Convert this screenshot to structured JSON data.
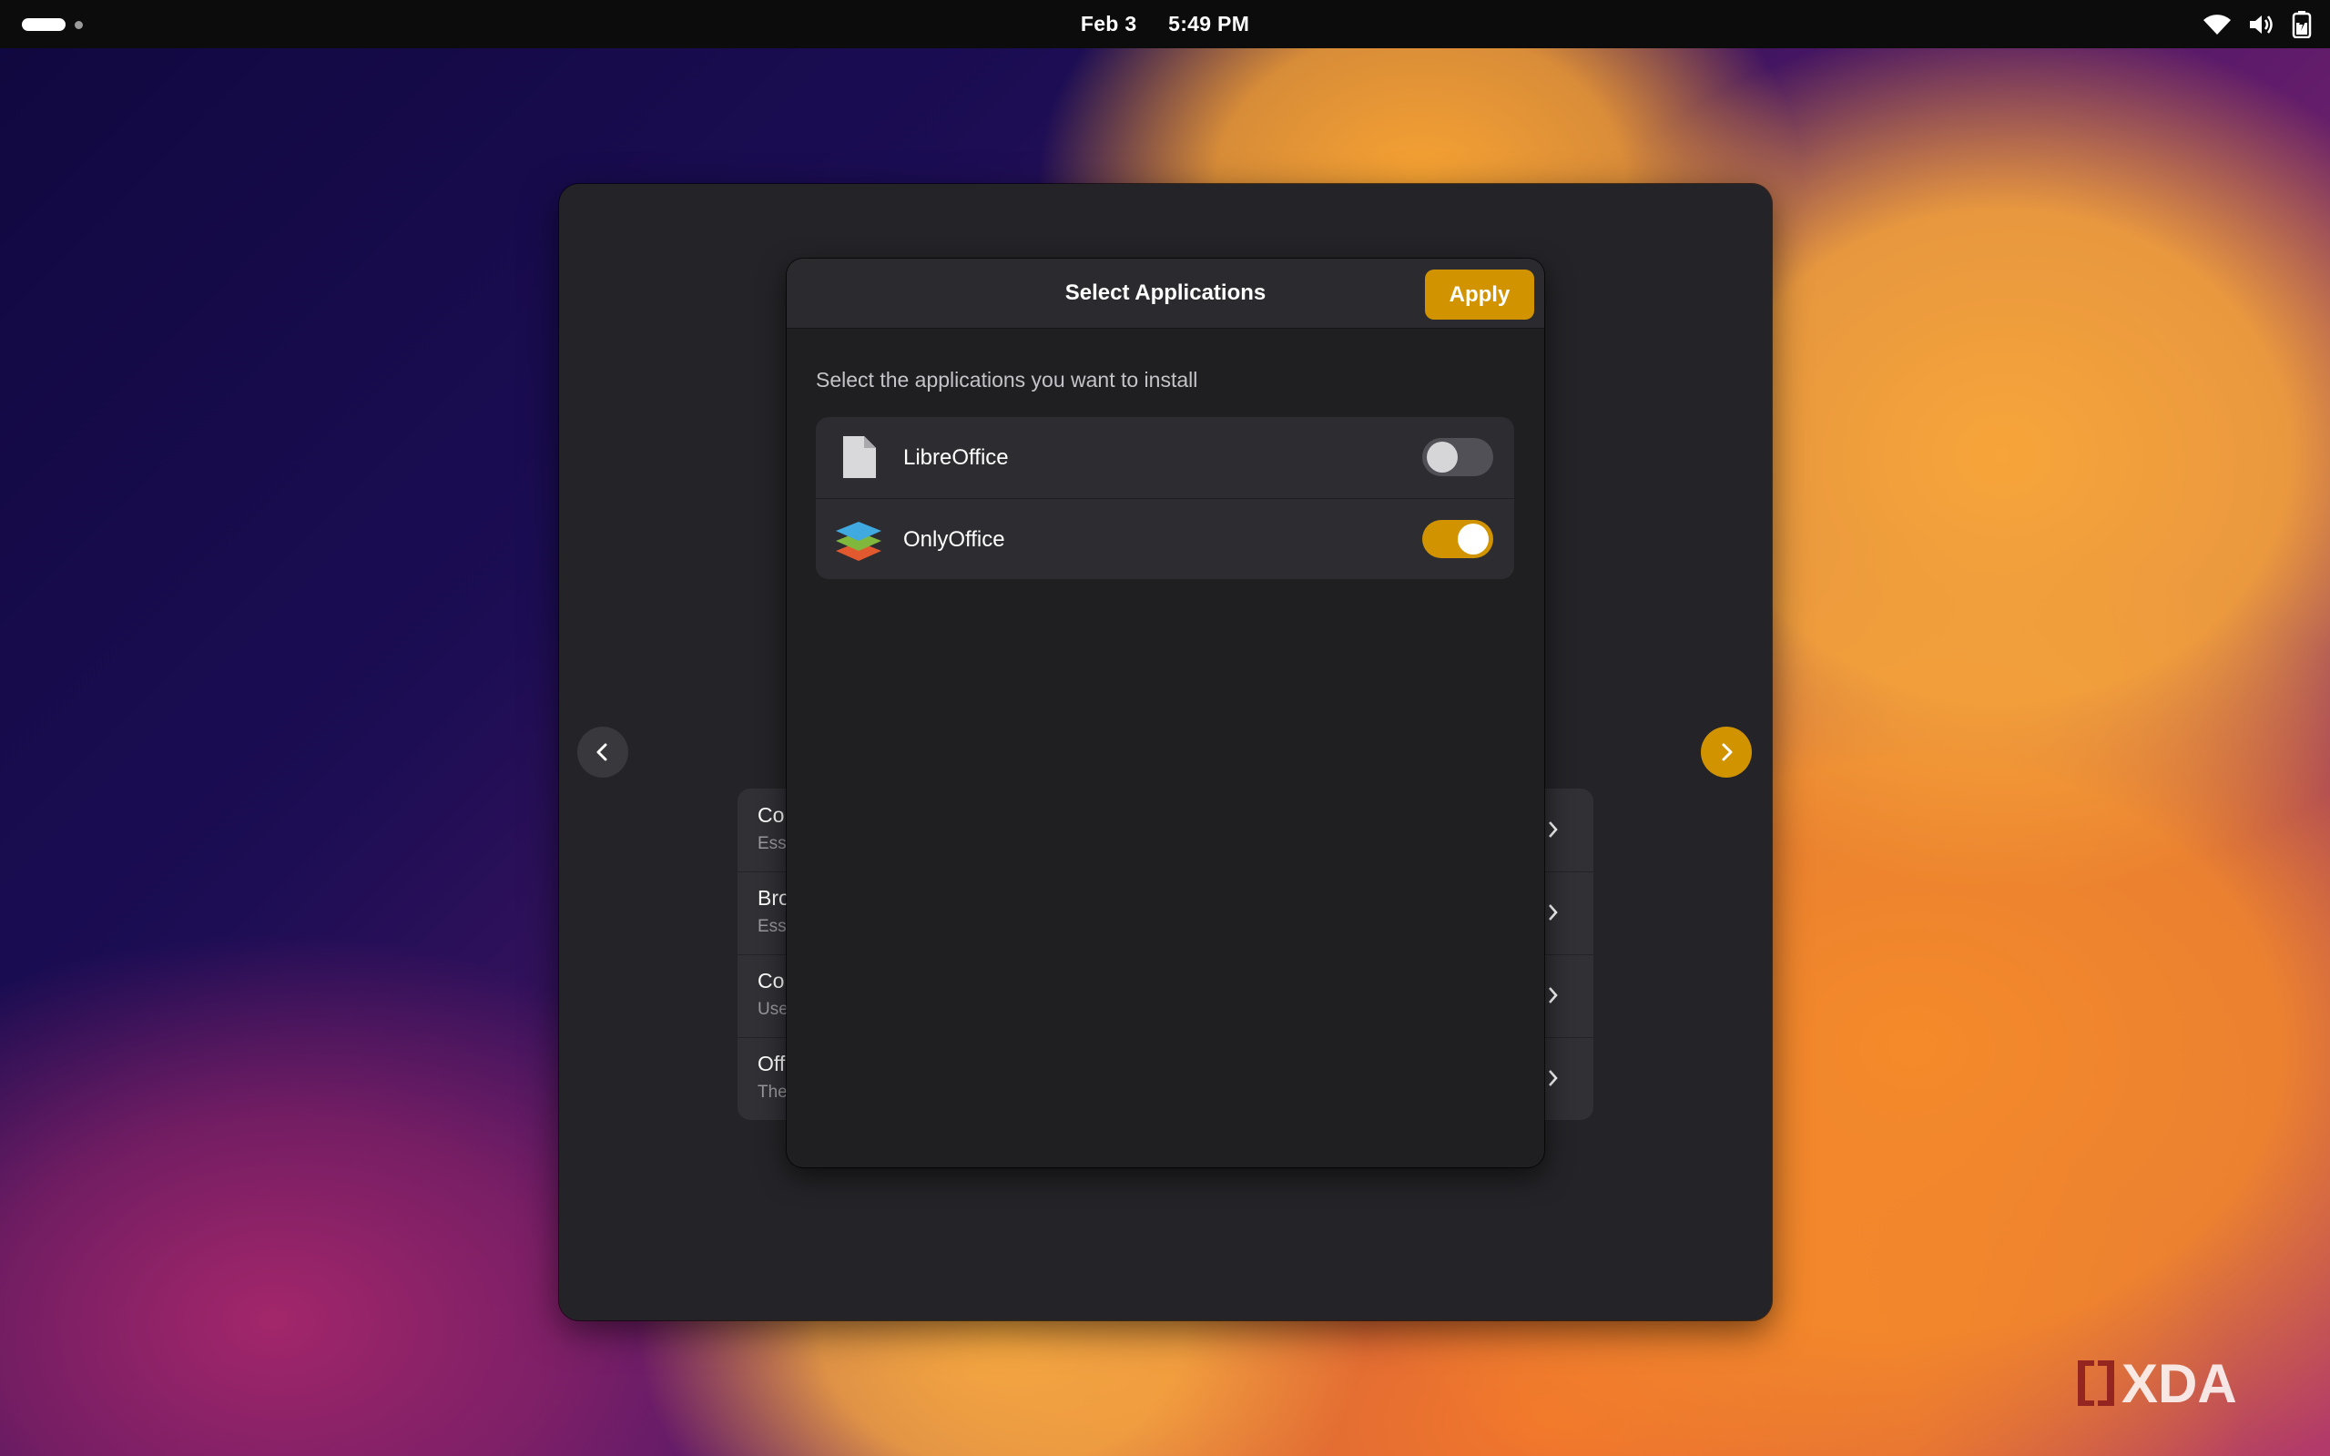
{
  "topbar": {
    "date": "Feb 3",
    "time": "5:49 PM",
    "icons": [
      "wifi-icon",
      "volume-icon",
      "battery-icon"
    ]
  },
  "background_list": {
    "items": [
      {
        "title": "Co",
        "subtitle": "Ess"
      },
      {
        "title": "Bro",
        "subtitle": "Ess"
      },
      {
        "title": "Co",
        "subtitle": "Use"
      },
      {
        "title": "Off",
        "subtitle": "The"
      }
    ]
  },
  "dialog": {
    "title": "Select Applications",
    "apply_label": "Apply",
    "description": "Select the applications you want to install",
    "apps": [
      {
        "name": "LibreOffice",
        "icon": "libreoffice-icon",
        "enabled": false
      },
      {
        "name": "OnlyOffice",
        "icon": "onlyoffice-icon",
        "enabled": true
      }
    ]
  },
  "watermark": {
    "text": "XDA"
  },
  "colors": {
    "accent": "#d19400",
    "window_bg": "#242428",
    "dialog_bg": "#1f1f22",
    "row_bg": "#2d2d31"
  }
}
